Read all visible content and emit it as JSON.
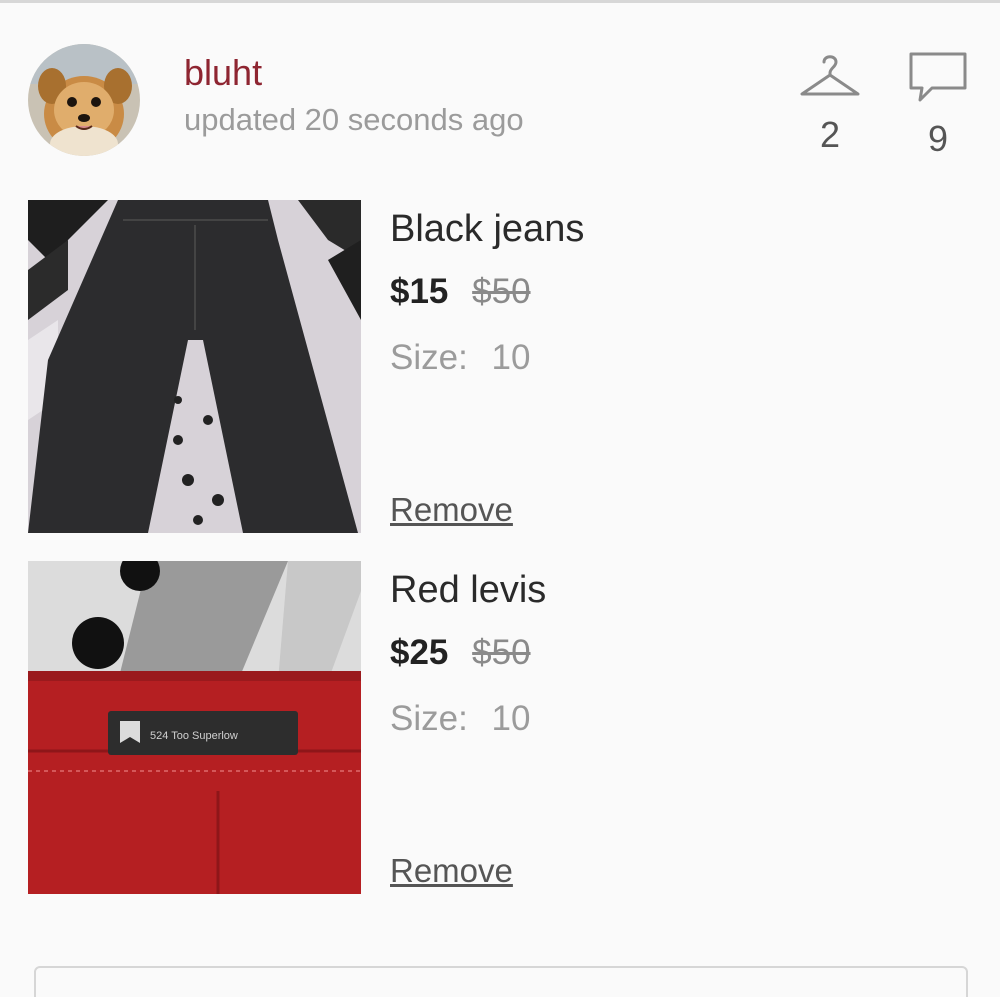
{
  "header": {
    "username": "bluht",
    "updated": "updated 20 seconds ago",
    "avatar_icon": "dog-avatar",
    "hanger_count": "2",
    "comment_count": "9",
    "username_color": "#8e2531"
  },
  "items": [
    {
      "title": "Black jeans",
      "price": "$15",
      "original_price": "$50",
      "size_label": "Size:",
      "size_value": "10",
      "remove_label": "Remove"
    },
    {
      "title": "Red levis",
      "price": "$25",
      "original_price": "$50",
      "size_label": "Size:",
      "size_value": "10",
      "remove_label": "Remove",
      "tag_text": "524 Too Superlow"
    }
  ]
}
